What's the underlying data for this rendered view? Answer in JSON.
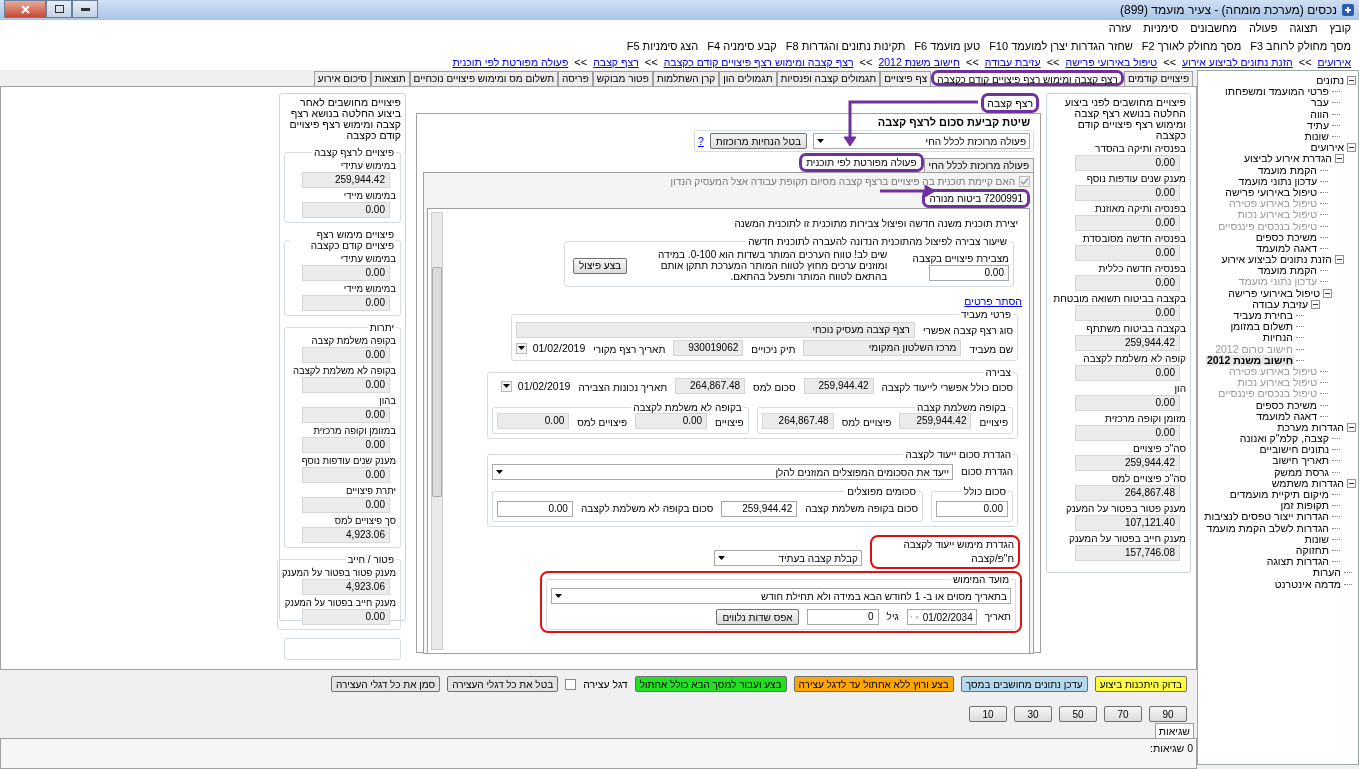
{
  "window": {
    "title": "נכסים (מערכת מומחה) - צעיר מועמד (899)"
  },
  "menu": [
    "קובץ",
    "תצוגה",
    "פעולה",
    "מחשבונים",
    "סימניות",
    "עזרה"
  ],
  "toolbar": [
    "מסך מחולק לרוחב F3",
    "מסך מחולק לאורך F2",
    "שחזר הגדרות יצרן למועמד F10",
    "טען מועמד F6",
    "תקינות נתונים והגדרות F8",
    "קבע סימניה F4",
    "הצג סימניות F5"
  ],
  "breadcrumb": [
    {
      "label": "אירועים",
      "separator": ">>"
    },
    {
      "label": "הזנת נתונים לביצוע אירוע",
      "separator": ">>"
    },
    {
      "label": "טיפול באירועי פרישה",
      "separator": ">>"
    },
    {
      "label": "עזיבת עבודה",
      "separator": ">>"
    },
    {
      "label": "חישוב משנת 2012",
      "separator": ">>"
    },
    {
      "label": "רצף קצבה ומימוש רצף פיצויים קודם כקצבה",
      "separator": ">>"
    },
    {
      "label": "רצף קצבה",
      "separator": ">>"
    },
    {
      "label": "פעולה מפורטת לפי תוכנית"
    }
  ],
  "tabs": [
    {
      "label": "פיצויים קודמים",
      "selected": false
    },
    {
      "label": "רצף קצבה ומימוש רצף פיצויים קודם כקצבה",
      "selected": true,
      "highlight": true
    },
    {
      "label": "צף פיצויים",
      "selected": false
    },
    {
      "label": "תגמולים קצבה ופנסיות",
      "selected": false
    },
    {
      "label": "תגמולים הון",
      "selected": false
    },
    {
      "label": "קרן השתלמות",
      "selected": false
    },
    {
      "label": "פטור מבוקש",
      "selected": false
    },
    {
      "label": "פריסה",
      "selected": false
    },
    {
      "label": "תשלום מס ומימוש פיצויים נוכחיים",
      "selected": false
    },
    {
      "label": "תוצאות",
      "selected": false
    },
    {
      "label": "סיכום אירוע",
      "selected": false
    }
  ],
  "before_panel": {
    "title": "פיצויים מחושבים לפני ביצוע החלטה בנושא רצף קצבה ומימוש רצף פיצויים קודם כקצבה",
    "fields": [
      {
        "label": "בפנסיה ותיקה בהסדר",
        "value": "0.00"
      },
      {
        "label": "מענק שנים עודפות נוסף",
        "value": "0.00"
      },
      {
        "label": "בפנסיה ותיקה מאוזנת",
        "value": "0.00"
      },
      {
        "label": "בפנסיה חדשה מסובסדת",
        "value": "0.00"
      },
      {
        "label": "בפנסיה חדשה כללית",
        "value": "0.00"
      },
      {
        "label": "בקצבה בביטוח תשואה מובטחת",
        "value": "0.00"
      },
      {
        "label": "בקצבה בביטוח משתתף",
        "value": "259,944.42"
      },
      {
        "label": "קופה לא משלמת לקצבה",
        "value": "0.00"
      },
      {
        "label": "הון",
        "value": "0.00"
      },
      {
        "label": "מזומן וקופה מרכזית",
        "value": "0.00"
      },
      {
        "label": "סה\"כ פיצויים",
        "value": "259,944.42"
      },
      {
        "label": "סה\"כ פיצויים למס",
        "value": "264,867.48"
      },
      {
        "label": "מענק פטור בפטור על המענק",
        "value": "107,121.40"
      },
      {
        "label": "מענק חייב בפטור על המענק",
        "value": "157,746.08"
      }
    ]
  },
  "after_panel": {
    "title": "פיצויים מחושבים לאחר ביצוע החלטה בנושא רצף קצבה ומימוש רצף פיצויים קודם כקצבה",
    "groups": [
      {
        "title": "פיצויים לרצף קצבה",
        "fields": [
          {
            "label": "במימוש עתידי",
            "value": "259,944.42"
          },
          {
            "label": "במימוש מיידי",
            "value": "0.00"
          }
        ]
      },
      {
        "title": "פיצויים מימוש רצף פיצויים קודם כקצבה",
        "fields": [
          {
            "label": "במימוש עתידי",
            "value": "0.00"
          },
          {
            "label": "במימוש מיידי",
            "value": "0.00"
          }
        ]
      },
      {
        "title": "יתרות",
        "fields": [
          {
            "label": "בקופה משלמת קצבה",
            "value": "0.00"
          },
          {
            "label": "בקופה לא משלמת לקצבה",
            "value": "0.00"
          },
          {
            "label": "בהון",
            "value": "0.00"
          },
          {
            "label": "במזומן וקופה מרכזית",
            "value": "0.00"
          },
          {
            "label": "מענק שנים עודפות נוסף",
            "value": "0.00"
          },
          {
            "label": "יתרת פיצויים",
            "value": "0.00"
          },
          {
            "label": "סך פיצויים למס",
            "value": "4,923.06"
          }
        ]
      },
      {
        "title": "פטור / חייב",
        "fields": [
          {
            "label": "מענק פטור בפטור על המענק",
            "value": "4,923.06"
          },
          {
            "label": "מענק חייב בפטור על המענק",
            "value": "0.00"
          }
        ]
      }
    ]
  },
  "pension": {
    "section_tab": {
      "label": "רצף קצבה",
      "highlight": true
    },
    "method": {
      "title": "שיטת קביעת סכום לרצף קצבה",
      "value": "פעולה מרוכזת לכלל החי",
      "cancel_button": "בטל הנחיות מרוכזות",
      "help": "?"
    },
    "mode_tabs": [
      {
        "label": "פעולה מרוכזת לכלל החי",
        "selected": false
      },
      {
        "label": "פעולה מפורטת לפי תוכנית",
        "selected": true,
        "highlight": true
      }
    ],
    "plan_question": {
      "label": "האם קיימת תוכנית בה פיצויים ברצף קצבה מסיום תקופת עבודה אצל המעסיק הנדון",
      "checked": true,
      "disabled": true
    },
    "plan_tabs": [
      {
        "label": "7200991 ביטוח מנורה",
        "selected": true,
        "highlight": true
      }
    ],
    "split": {
      "title": "יצירת תוכנית משנה חדשה ופיצול צבירות מתוכנית זו לתוכנית המשנה",
      "group_title": "שיעור צבירה לפיצול מהתוכנית הנדונה להעברה לתוכנית חדשה",
      "field_label": "מצבירת פיצויים בקצבה",
      "value": "0.00",
      "note": "שים לב! טווח הערכים המותר בשדות הוא 0-100. במידה ומוזנים ערכים מחוץ לטווח המותר המערכת תתקן אותם בהתאם לטווח המותר ותפעל בהתאם.",
      "button": "בצע פיצול"
    },
    "hide_link": "הסתר פרטים",
    "employer": {
      "title": "פרטי מעביד",
      "continuity_label": "סוג רצף קצבה אפשרי",
      "continuity": "רצף קצבה מעסיק נוכחי",
      "name_label": "שם מעביד",
      "name": "מרכז השלטון המקומי",
      "file_label": "תיק ניכויים",
      "file": "930019062",
      "date_label": "תאריך רצף מקורי",
      "date": "01/02/2019"
    },
    "accrual": {
      "title": "צבירה",
      "total_label": "סכום כולל אפשרי לייעוד לקצבה",
      "total": "259,944.42",
      "tax_label": "סכום למס",
      "tax": "264,867.48",
      "date_label": "תאריך נכונות הצבירה",
      "date": "01/02/2019",
      "funds": [
        {
          "title": "בקופה משלמת קצבה",
          "comp_label": "פיצויים",
          "comp": "259,944.42",
          "tax_label": "פיצויים למס",
          "tax": "264,867.48"
        },
        {
          "title": "בקופה לא משלמת לקצבה",
          "comp_label": "פיצויים",
          "comp": "0.00",
          "tax_label": "פיצויים למס",
          "tax": "0.00"
        }
      ]
    },
    "designation": {
      "title": "הגדרת סכום ייעוד לקצבה",
      "mode_label": "הגדרת סכום",
      "mode": "ייעד את הסכומים המפוצלים המוזנים להלן",
      "total_title": "סכום כולל",
      "total": "0.00",
      "split_title": "סכומים מפוצלים",
      "paying_label": "סכום בקופה משלמת קצבה",
      "paying": "259,944.42",
      "nonpaying_label": "סכום בקופה לא משלמת לקצבה",
      "nonpaying": "0.00"
    },
    "realization": {
      "title": "הגדרת מימוש ייעוד לקצבה",
      "type_label": "ח\"פ/קצבה",
      "type": "קבלת קצבה בעתיד",
      "highlight": true
    },
    "timing": {
      "title": "מועד המימוש",
      "mode": "בתאריך מסוים או ב- 1 לחודש הבא במידה ולא תחילת חודש",
      "date_label": "תאריך",
      "date": "01/02/2034",
      "age_label": "גיל",
      "age": "0",
      "reset_button": "אפס שדות נלווים",
      "highlight": true
    }
  },
  "actions": [
    {
      "kind": "button",
      "label": "בדוק היתכנות ביצוע",
      "color": "#ffff40"
    },
    {
      "kind": "button",
      "label": "עדכן נתונים מחושבים במסך",
      "color": "#b4d8ee"
    },
    {
      "kind": "button",
      "label": "בצע ורוץ ללא אחתול עד לדגל עצירה",
      "color": "#ffa500"
    },
    {
      "kind": "button",
      "label": "בצע ועבור למסך הבא כולל אחתול",
      "color": "#20e020"
    },
    {
      "kind": "checkbox",
      "label": "דגל עצירה",
      "checked": false
    },
    {
      "kind": "button",
      "label": "בטל את כל דגלי העצירה",
      "color": "#e4e4e4"
    },
    {
      "kind": "button",
      "label": "סמן את כל דגלי העצירה",
      "color": "#e4e4e4"
    }
  ],
  "step_buttons": [
    "90",
    "70",
    "50",
    "30",
    "10"
  ],
  "errors": {
    "tab": "שגיאות",
    "summary": "0 שגיאות:"
  },
  "tree": [
    {
      "label": "נתונים",
      "expanded": true,
      "disabled": false,
      "selected": false,
      "children": [
        {
          "label": "פרטי המועמד ומשפחתו",
          "disabled": false,
          "selected": false
        },
        {
          "label": "עבר",
          "disabled": false,
          "selected": false
        },
        {
          "label": "הווה",
          "disabled": false,
          "selected": false
        },
        {
          "label": "עתיד",
          "disabled": false,
          "selected": false
        },
        {
          "label": "שונות",
          "disabled": false,
          "selected": false
        }
      ]
    },
    {
      "label": "אירועים",
      "expanded": true,
      "disabled": false,
      "selected": false,
      "children": [
        {
          "label": "הגדרת אירוע לביצוע",
          "expanded": true,
          "disabled": false,
          "selected": false,
          "children": [
            {
              "label": "הקמת מועמד",
              "disabled": false,
              "selected": false
            },
            {
              "label": "עדכון נתוני מועמד",
              "disabled": false,
              "selected": false
            },
            {
              "label": "טיפול באירועי פרישה",
              "disabled": false,
              "selected": false
            },
            {
              "label": "טיפול באירוע פטירה",
              "disabled": true,
              "selected": false
            },
            {
              "label": "טיפול באירוע נכות",
              "disabled": true,
              "selected": false
            },
            {
              "label": "טיפול בנכסים פיננסיים",
              "disabled": true,
              "selected": false
            },
            {
              "label": "משיכת כספים",
              "disabled": false,
              "selected": false
            },
            {
              "label": "דאגה למועמד",
              "disabled": false,
              "selected": false
            }
          ]
        },
        {
          "label": "הזנת נתונים לביצוע אירוע",
          "expanded": true,
          "disabled": false,
          "selected": false,
          "children": [
            {
              "label": "הקמת מועמד",
              "disabled": false,
              "selected": false
            },
            {
              "label": "עדכון נתוני מועמד",
              "disabled": true,
              "selected": false
            },
            {
              "label": "טיפול באירועי פרישה",
              "expanded": true,
              "disabled": false,
              "selected": false,
              "children": [
                {
                  "label": "עזיבת עבודה",
                  "expanded": true,
                  "disabled": false,
                  "selected": false,
                  "children": [
                    {
                      "label": "בחירת מעביד",
                      "disabled": false,
                      "selected": false
                    },
                    {
                      "label": "תשלום במזומן",
                      "disabled": false,
                      "selected": false
                    },
                    {
                      "label": "הנחיות",
                      "disabled": false,
                      "selected": false
                    },
                    {
                      "label": "חישוב טרום 2012",
                      "disabled": true,
                      "selected": false
                    },
                    {
                      "label": "חישוב משנת 2012",
                      "disabled": false,
                      "selected": true
                    }
                  ]
                }
              ]
            },
            {
              "label": "טיפול באירוע פטירה",
              "disabled": true,
              "selected": false
            },
            {
              "label": "טיפול באירוע נכות",
              "disabled": true,
              "selected": false
            },
            {
              "label": "טיפול בנכסים פיננסיים",
              "disabled": true,
              "selected": false
            },
            {
              "label": "משיכת כספים",
              "disabled": false,
              "selected": false
            },
            {
              "label": "דאגה למועמד",
              "disabled": false,
              "selected": false
            }
          ]
        }
      ]
    },
    {
      "label": "הגדרות מערכת",
      "expanded": true,
      "disabled": false,
      "selected": false,
      "children": [
        {
          "label": "קצבה, קלמ\"ק ואנונה",
          "disabled": false,
          "selected": false
        },
        {
          "label": "נתונים חישוביים",
          "disabled": false,
          "selected": false
        },
        {
          "label": "תאריך חישוב",
          "disabled": false,
          "selected": false
        },
        {
          "label": "גרסת ממשק",
          "disabled": false,
          "selected": false
        }
      ]
    },
    {
      "label": "הגדרות משתמש",
      "expanded": true,
      "disabled": false,
      "selected": false,
      "children": [
        {
          "label": "מיקום תיקיית מועמדים",
          "disabled": false,
          "selected": false
        },
        {
          "label": "תקופות זמן",
          "disabled": false,
          "selected": false
        },
        {
          "label": "הגדרות ייצור טפסים לנציבות",
          "disabled": false,
          "selected": false
        },
        {
          "label": "הגדרות לשלב הקמת מועמד",
          "disabled": false,
          "selected": false
        },
        {
          "label": "שונות",
          "disabled": false,
          "selected": false
        },
        {
          "label": "תחזוקה",
          "disabled": false,
          "selected": false
        },
        {
          "label": "הגדרות תצוגה",
          "disabled": false,
          "selected": false
        }
      ]
    },
    {
      "label": "הערות",
      "disabled": false,
      "selected": false
    },
    {
      "label": "מדמה אינטרנט",
      "disabled": false,
      "selected": false
    }
  ]
}
